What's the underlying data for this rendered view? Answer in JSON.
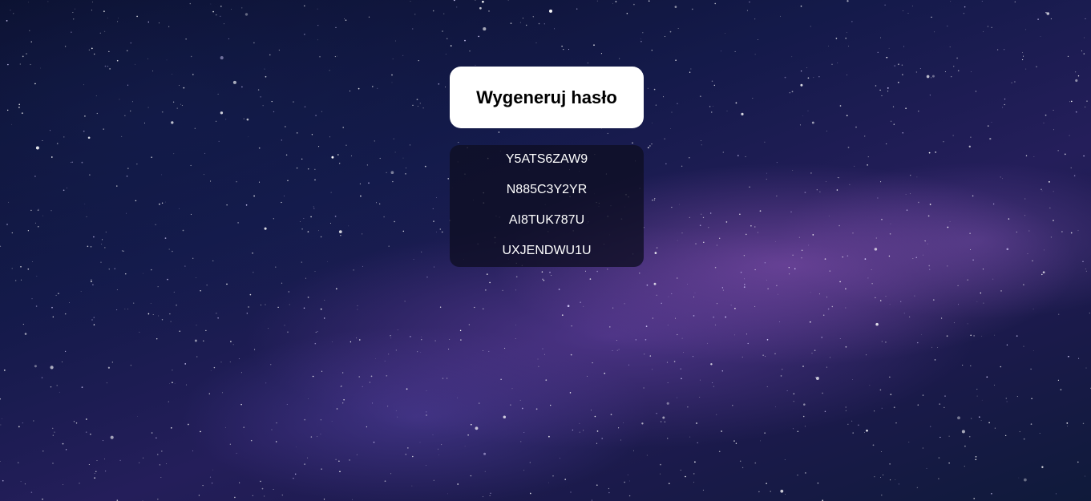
{
  "generate_button": {
    "label": "Wygeneruj hasło"
  },
  "passwords": [
    "Y5ATS6ZAW9",
    "N885C3Y2YR",
    "AI8TUK787U",
    "UXJENDWU1U"
  ],
  "colors": {
    "button_bg": "#ffffff",
    "button_text": "#000000",
    "list_bg": "#0e0e22",
    "list_text": "#ffffff"
  }
}
